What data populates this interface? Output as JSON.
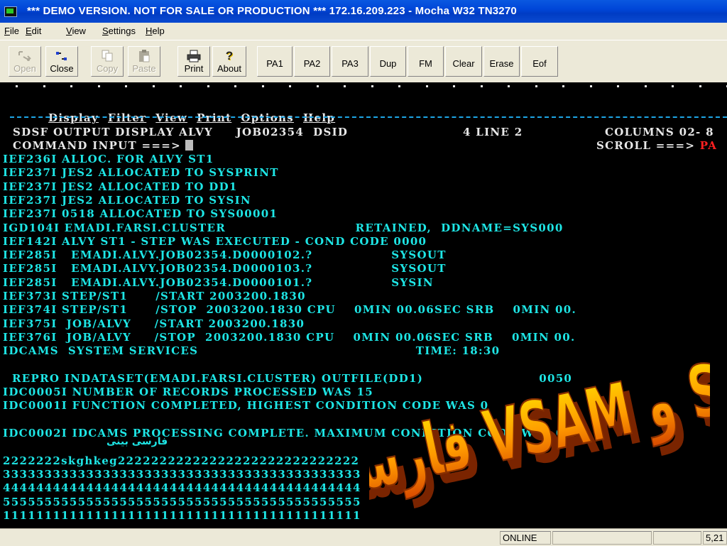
{
  "window": {
    "title": "*** DEMO VERSION. NOT FOR SALE OR PRODUCTION  ***  172.16.209.223 - Mocha W32 TN3270"
  },
  "menu": [
    "File",
    "Edit",
    "View",
    "Settings",
    "Help"
  ],
  "toolbar": {
    "icon_buttons": [
      {
        "label": "Open",
        "icon": "open-connection-icon",
        "enabled": false
      },
      {
        "label": "Close",
        "icon": "close-connection-icon",
        "enabled": true
      },
      {
        "label": "Copy",
        "icon": "copy-icon",
        "enabled": false
      },
      {
        "label": "Paste",
        "icon": "paste-icon",
        "enabled": false
      },
      {
        "label": "Print",
        "icon": "printer-icon",
        "enabled": true
      },
      {
        "label": "About",
        "icon": "question-mark-icon",
        "enabled": true
      }
    ],
    "key_buttons": [
      "PA1",
      "PA2",
      "PA3",
      "Dup",
      "FM",
      "Clear",
      "Erase",
      "Eof"
    ]
  },
  "terminal": {
    "action_bar": [
      "Display",
      "Filter",
      "View",
      "Print",
      "Options",
      "Help"
    ],
    "header1": {
      "left": "SDSF OUTPUT DISPLAY ALVY     JOB02354  DSID",
      "mid": "4 LINE 2",
      "right": "COLUMNS 02- 8"
    },
    "header2": {
      "left": "COMMAND INPUT ===>",
      "right": "SCROLL ===>",
      "scroll_value": "PA"
    },
    "lines": [
      "IEF236I ALLOC. FOR ALVY ST1",
      "IEF237I JES2 ALLOCATED TO SYSPRINT",
      "IEF237I JES2 ALLOCATED TO DD1",
      "IEF237I JES2 ALLOCATED TO SYSIN",
      "IEF237I 0518 ALLOCATED TO SYS00001",
      "IGD104I EMADI.FARSI.CLUSTER                            RETAINED,  DDNAME=SYS000",
      "IEF142I ALVY ST1 - STEP WAS EXECUTED - COND CODE 0000",
      "IEF285I   EMADI.ALVY.JOB02354.D0000102.?                 SYSOUT",
      "IEF285I   EMADI.ALVY.JOB02354.D0000103.?                 SYSOUT",
      "IEF285I   EMADI.ALVY.JOB02354.D0000101.?                 SYSIN",
      "IEF373I STEP/ST1      /START 2003200.1830",
      "IEF374I STEP/ST1      /STOP  2003200.1830 CPU    0MIN 00.06SEC SRB    0MIN 00.",
      "IEF375I  JOB/ALVY     /START 2003200.1830",
      "IEF376I  JOB/ALVY     /STOP  2003200.1830 CPU    0MIN 00.06SEC SRB    0MIN 00.",
      "IDCAMS  SYSTEM SERVICES                                               TIME: 18:30",
      "",
      "  REPRO INDATASET(EMADI.FARSI.CLUSTER) OUTFILE(DD1)                         0050",
      "IDC0005I NUMBER OF RECORDS PROCESSED WAS 15",
      "IDC0001I FUNCTION COMPLETED, HIGHEST CONDITION CODE WAS 0",
      "",
      "IDC0002I IDCAMS PROCESSING COMPLETE. MAXIMUM CONDITION CODE WAS 0",
      "",
      "2222222skghkeg22222222222222222222222222222",
      "3333333333333333333333333333333333333333333",
      "4444444444444444444444444444444444444444444",
      "5555555555555555555555555555555555555555555",
      "1111111111111111111111111111111111111111111"
    ],
    "farsi_inline": "فارسی بینی"
  },
  "overlay_text": "فارسی در VSAM و SDSF",
  "status": {
    "state": "ONLINE",
    "cursor_pos": "5,21"
  }
}
